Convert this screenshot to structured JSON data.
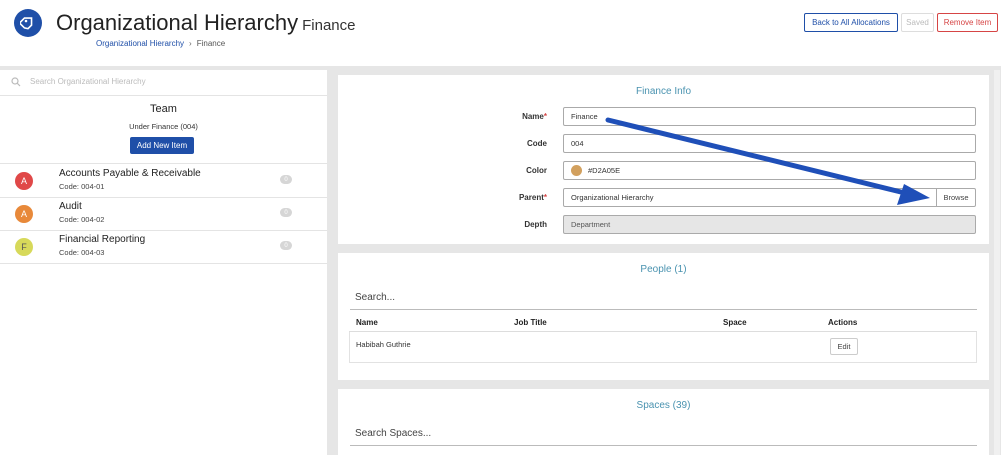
{
  "header": {
    "title": "Organizational Hierarchy",
    "subtitle": "Finance",
    "breadcrumb": {
      "root": "Organizational Hierarchy",
      "current": "Finance"
    },
    "buttons": {
      "back": "Back to All Allocations",
      "saved": "Saved",
      "remove": "Remove Item"
    }
  },
  "sidebar": {
    "search_placeholder": "Search Organizational Hierarchy",
    "team": {
      "title": "Team",
      "under": "Under Finance (004)",
      "add_label": "Add New Item"
    },
    "items": [
      {
        "initial": "A",
        "name": "Accounts Payable & Receivable",
        "code": "Code: 004-01",
        "count": "0",
        "color": "#e04848"
      },
      {
        "initial": "A",
        "name": "Audit",
        "code": "Code: 004-02",
        "count": "0",
        "color": "#e8893a"
      },
      {
        "initial": "F",
        "name": "Financial Reporting",
        "code": "Code: 004-03",
        "count": "0",
        "color": "#d7d95a"
      }
    ]
  },
  "info": {
    "title": "Finance Info",
    "fields": {
      "name": {
        "label": "Name",
        "value": "Finance"
      },
      "code": {
        "label": "Code",
        "value": "004"
      },
      "color": {
        "label": "Color",
        "value": "#D2A05E"
      },
      "parent": {
        "label": "Parent",
        "value": "Organizational Hierarchy",
        "browse": "Browse"
      },
      "depth": {
        "label": "Depth",
        "value": "Department"
      }
    }
  },
  "people": {
    "title": "People (1)",
    "search_placeholder": "Search...",
    "columns": [
      "Name",
      "Job Title",
      "Space",
      "Actions"
    ],
    "rows": [
      {
        "name": "Habibah Guthrie",
        "job_title": "",
        "space": "",
        "action": "Edit"
      }
    ]
  },
  "spaces": {
    "title": "Spaces (39)",
    "search_placeholder": "Search Spaces..."
  },
  "colors": {
    "brand": "#1f4fa8",
    "accent_title": "#4a93b0",
    "danger": "#d64545",
    "annotation_arrow": "#1f4fb8"
  }
}
